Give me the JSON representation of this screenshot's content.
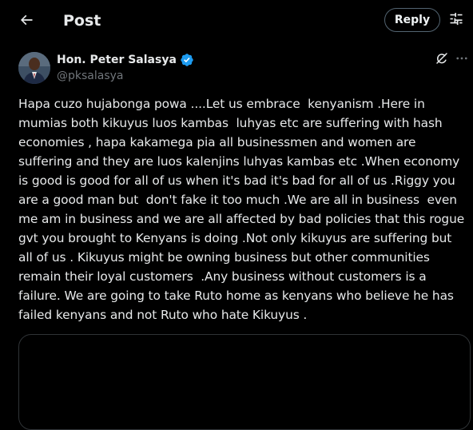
{
  "header": {
    "back_icon": "arrow-left-icon",
    "title": "Post",
    "reply_label": "Reply",
    "settings_icon": "sliders-icon"
  },
  "post": {
    "author_name": "Hon. Peter Salasya",
    "verified": true,
    "verified_color": "#1d9bf0",
    "handle": "@pksalasya",
    "grok_icon": "grok-icon",
    "more_icon": "more-horizontal-icon",
    "text": "Hapa cuzo hujabonga powa ....Let us embrace  kenyanism .Here in\nmumias both kikuyus luos kambas  luhyas etc are suffering with hash\neconomies , hapa kakamega pia all businessmen and women are\nsuffering and they are luos kalenjins luhyas kambas etc .When economy\nis good is good for all of us when it's bad it's bad for all of us .Riggy you\nare a good man but  don't fake it too much .We are all in business  even\nme am in business and we are all affected by bad policies that this rogue\ngvt you brought to Kenyans is doing .Not only kikuyus are suffering but\nall of us . Kikuyus might be owning business but other communities\nremain their loyal customers  .Any business without customers is a\nfailure. We are going to take Ruto home as kenyans who believe he has\nfailed kenyans and not Ruto who hate Kikuyus ."
  }
}
